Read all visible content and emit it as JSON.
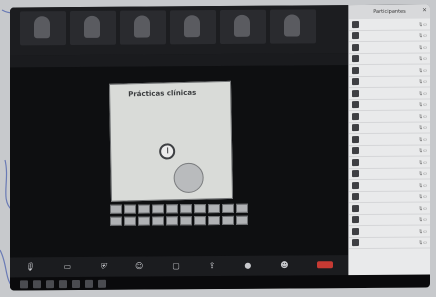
{
  "view_bar": {
    "view_label": "",
    "view_option": ""
  },
  "video_tiles": [
    {
      "label": ""
    },
    {
      "label": ""
    },
    {
      "label": ""
    },
    {
      "label": ""
    },
    {
      "label": ""
    },
    {
      "label": ""
    }
  ],
  "slide": {
    "title": "Prácticas clínicas",
    "lines": [
      "",
      "",
      ""
    ],
    "side_text": [
      "",
      ""
    ]
  },
  "panel": {
    "title": "Participantes",
    "participants": [
      {
        "name": ""
      },
      {
        "name": ""
      },
      {
        "name": ""
      },
      {
        "name": ""
      },
      {
        "name": ""
      },
      {
        "name": ""
      },
      {
        "name": ""
      },
      {
        "name": ""
      },
      {
        "name": ""
      },
      {
        "name": ""
      },
      {
        "name": ""
      },
      {
        "name": ""
      },
      {
        "name": ""
      },
      {
        "name": ""
      },
      {
        "name": ""
      },
      {
        "name": ""
      },
      {
        "name": ""
      },
      {
        "name": ""
      },
      {
        "name": ""
      },
      {
        "name": ""
      }
    ],
    "footer": {
      "invite": "",
      "mute_all": ""
    }
  },
  "toolbar": {
    "labels": [
      "",
      "",
      "",
      "",
      "",
      "",
      "",
      "",
      ""
    ]
  },
  "taskbar": {
    "time": ""
  },
  "colors": {
    "end_button": "#c63a33",
    "panel_bg": "#e9eaeb",
    "screen_bg": "#131416"
  },
  "icons": [
    "microphone-icon",
    "camera-icon",
    "security-icon",
    "participants-icon",
    "chat-icon",
    "share-screen-icon",
    "record-icon",
    "reactions-icon",
    "end-call-icon"
  ]
}
